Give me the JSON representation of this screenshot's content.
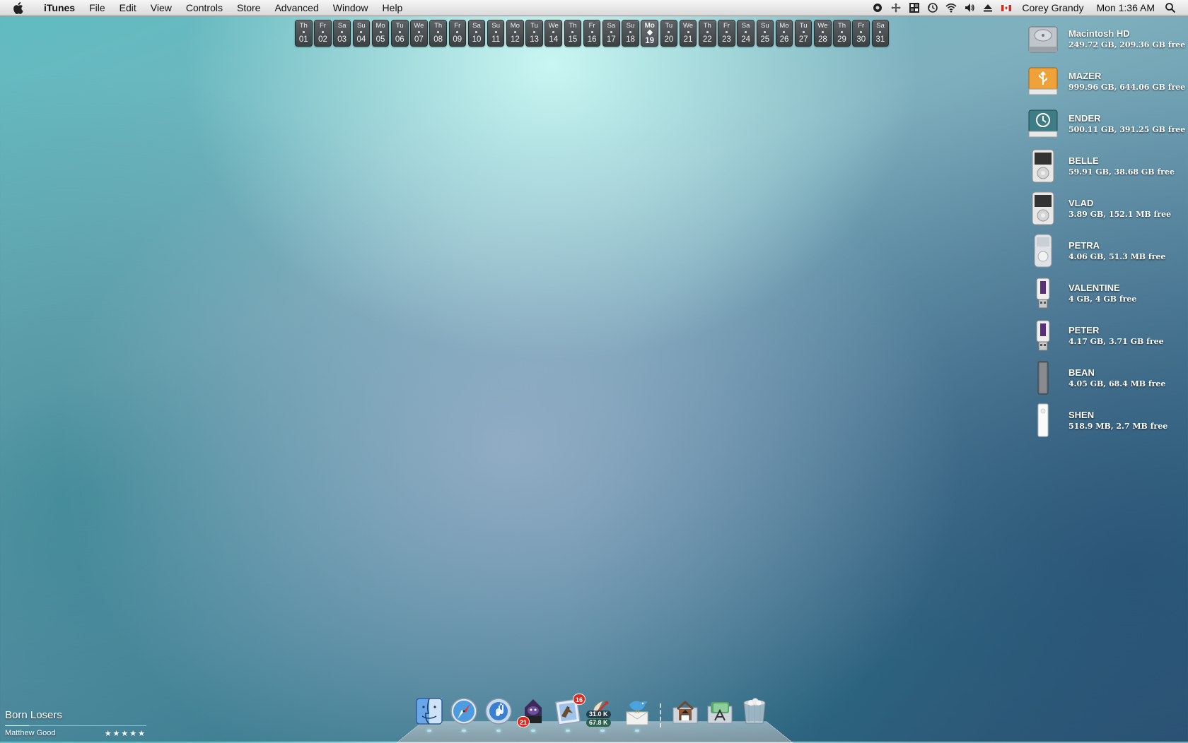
{
  "menubar": {
    "app_name": "iTunes",
    "menus": [
      "File",
      "Edit",
      "View",
      "Controls",
      "Store",
      "Advanced",
      "Window",
      "Help"
    ],
    "status_icons": [
      "record-icon",
      "move-icon",
      "spaces-icon",
      "time-machine-icon",
      "wifi-icon",
      "volume-icon",
      "eject-icon",
      "canada-flag-icon"
    ],
    "user": "Corey Grandy",
    "clock": "Mon 1:36 AM",
    "search_icon": "spotlight-search-icon"
  },
  "calendar": {
    "today_index": 18,
    "days": [
      {
        "dow": "Th",
        "num": "01"
      },
      {
        "dow": "Fr",
        "num": "02"
      },
      {
        "dow": "Sa",
        "num": "03"
      },
      {
        "dow": "Su",
        "num": "04"
      },
      {
        "dow": "Mo",
        "num": "05"
      },
      {
        "dow": "Tu",
        "num": "06"
      },
      {
        "dow": "We",
        "num": "07"
      },
      {
        "dow": "Th",
        "num": "08"
      },
      {
        "dow": "Fr",
        "num": "09"
      },
      {
        "dow": "Sa",
        "num": "10"
      },
      {
        "dow": "Su",
        "num": "11"
      },
      {
        "dow": "Mo",
        "num": "12"
      },
      {
        "dow": "Tu",
        "num": "13"
      },
      {
        "dow": "We",
        "num": "14"
      },
      {
        "dow": "Th",
        "num": "15"
      },
      {
        "dow": "Fr",
        "num": "16"
      },
      {
        "dow": "Sa",
        "num": "17"
      },
      {
        "dow": "Su",
        "num": "18"
      },
      {
        "dow": "Mo",
        "num": "19"
      },
      {
        "dow": "Tu",
        "num": "20"
      },
      {
        "dow": "We",
        "num": "21"
      },
      {
        "dow": "Th",
        "num": "22"
      },
      {
        "dow": "Fr",
        "num": "23"
      },
      {
        "dow": "Sa",
        "num": "24"
      },
      {
        "dow": "Su",
        "num": "25"
      },
      {
        "dow": "Mo",
        "num": "26"
      },
      {
        "dow": "Tu",
        "num": "27"
      },
      {
        "dow": "We",
        "num": "28"
      },
      {
        "dow": "Th",
        "num": "29"
      },
      {
        "dow": "Fr",
        "num": "30"
      },
      {
        "dow": "Sa",
        "num": "31"
      }
    ]
  },
  "drives": [
    {
      "name": "Macintosh HD",
      "info": "249.72 GB, 209.36 GB free",
      "icon": "hard-drive-icon"
    },
    {
      "name": "MAZER",
      "info": "999.96 GB, 644.06 GB free",
      "icon": "usb-drive-icon"
    },
    {
      "name": "ENDER",
      "info": "500.11 GB, 391.25 GB free",
      "icon": "time-machine-drive-icon"
    },
    {
      "name": "BELLE",
      "info": "59.91 GB, 38.68 GB free",
      "icon": "ipod-classic-icon"
    },
    {
      "name": "VLAD",
      "info": "3.89 GB, 152.1 MB free",
      "icon": "ipod-classic-icon"
    },
    {
      "name": "PETRA",
      "info": "4.06 GB, 51.3 MB free",
      "icon": "ipod-mini-icon"
    },
    {
      "name": "VALENTINE",
      "info": "4 GB, 4 GB free",
      "icon": "usb-stick-icon"
    },
    {
      "name": "PETER",
      "info": "4.17 GB, 3.71 GB free",
      "icon": "usb-stick-icon"
    },
    {
      "name": "BEAN",
      "info": "4.05 GB, 68.4 MB free",
      "icon": "ipod-nano-icon"
    },
    {
      "name": "SHEN",
      "info": "518.9 MB, 2.7 MB free",
      "icon": "ipod-shuffle-icon"
    }
  ],
  "now_playing": {
    "title": "Born Losers",
    "artist": "Matthew Good",
    "rating_text": "★★★★★",
    "progress": 0.17
  },
  "dock": {
    "items": [
      {
        "name": "finder",
        "icon": "finder-icon"
      },
      {
        "name": "safari",
        "icon": "safari-icon"
      },
      {
        "name": "itunes",
        "icon": "itunes-icon"
      },
      {
        "name": "adium",
        "icon": "adium-icon",
        "badge": "21"
      },
      {
        "name": "mail",
        "icon": "mail-icon",
        "badge": "16"
      },
      {
        "name": "network-monitor",
        "icon": "satellite-icon",
        "up": "31.0 K",
        "down": "67.8 K"
      },
      {
        "name": "twitter",
        "icon": "bird-icon"
      }
    ],
    "stacks": [
      {
        "name": "home",
        "icon": "home-folder-icon"
      },
      {
        "name": "applications",
        "icon": "applications-folder-icon"
      },
      {
        "name": "trash",
        "icon": "trash-icon"
      }
    ]
  }
}
